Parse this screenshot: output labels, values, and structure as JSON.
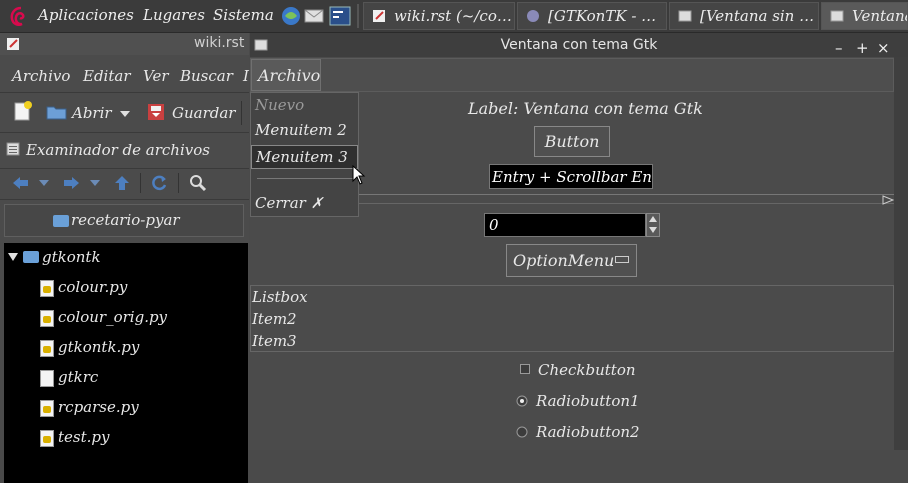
{
  "panel": {
    "menus": [
      "Aplicaciones",
      "Lugares",
      "Sistema"
    ],
    "tasks": [
      {
        "label": "wiki.rst (~/co…"
      },
      {
        "label": "[GTKonTK - …"
      },
      {
        "label": "[Ventana sin …"
      },
      {
        "label": "Ventana"
      }
    ]
  },
  "gedit": {
    "title": "wiki.rst",
    "menu": [
      "Archivo",
      "Editar",
      "Ver",
      "Buscar",
      "I"
    ],
    "toolbar": {
      "open": "Abrir",
      "save": "Guardar"
    },
    "sidepane_title": "Examinador de archivos",
    "location": "recetario-pyar",
    "tree": [
      {
        "label": "gtkontk",
        "type": "folder"
      },
      {
        "label": "colour.py",
        "type": "py"
      },
      {
        "label": "colour_orig.py",
        "type": "py"
      },
      {
        "label": "gtkontk.py",
        "type": "py"
      },
      {
        "label": "gtkrc",
        "type": "text"
      },
      {
        "label": "rcparse.py",
        "type": "py"
      },
      {
        "label": "test.py",
        "type": "py"
      }
    ]
  },
  "gtkwin": {
    "title": "Ventana con tema Gtk",
    "wm": {
      "minimize": "–",
      "maximize": "+",
      "close": "×"
    },
    "menubar": {
      "archivo": "Archivo"
    },
    "dropdown": [
      {
        "label": "Nuevo",
        "disabled": true
      },
      {
        "label": "Menuitem 2"
      },
      {
        "label": "Menuitem 3",
        "selected": true
      },
      {
        "label": "Cerrar ✗"
      }
    ],
    "label": "Label: Ventana con tema Gtk",
    "button": "Button",
    "entry": "Entry + Scrollbar Entry",
    "spin_value": "0",
    "option_menu": "OptionMenu",
    "listbox": [
      "Listbox",
      "Item2",
      "Item3"
    ],
    "checkbutton": "Checkbutton",
    "radios": [
      "Radiobutton1",
      "Radiobutton2"
    ]
  }
}
